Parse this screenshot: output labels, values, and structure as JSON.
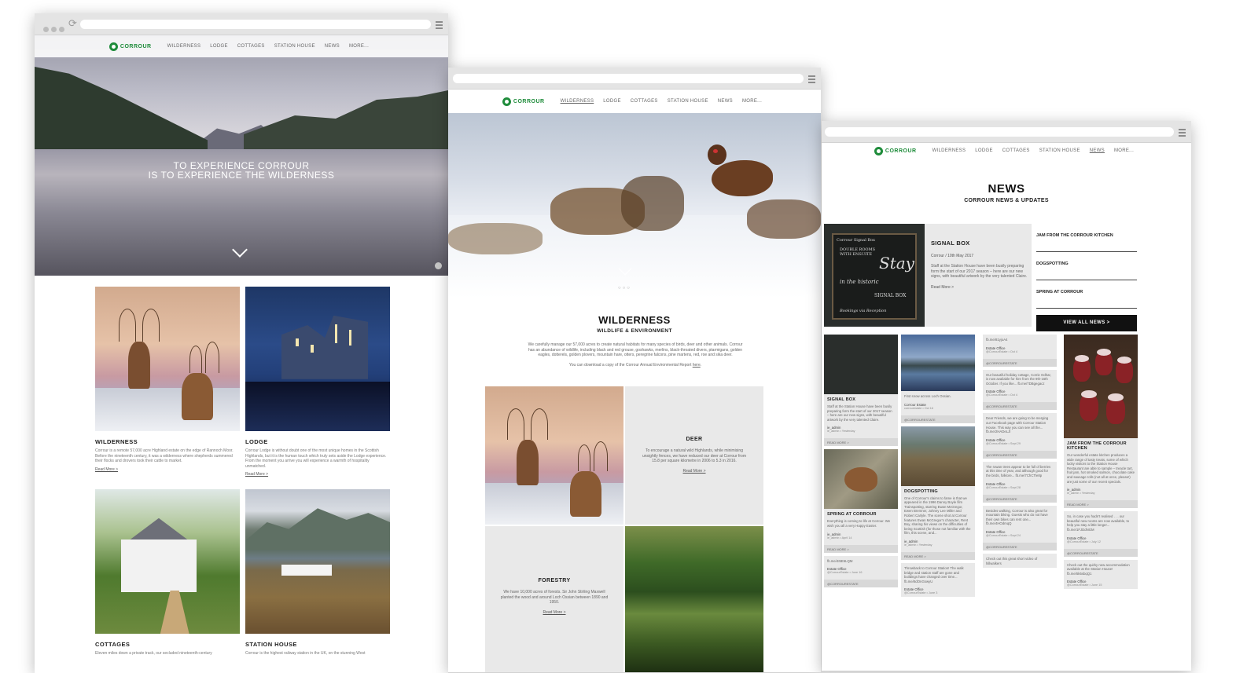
{
  "brand": {
    "name": "CORROUR",
    "color": "#1f8c3b"
  },
  "nav": [
    "WILDERNESS",
    "LODGE",
    "COTTAGES",
    "STATION HOUSE",
    "NEWS",
    "MORE..."
  ],
  "home": {
    "tagline_1": "TO EXPERIENCE CORROUR",
    "tagline_2": "IS TO EXPERIENCE THE WILDERNESS",
    "cards": [
      {
        "title": "WILDERNESS",
        "text": "Corrour is a remote 57,000 acre Highland estate on the edge of Rannoch Moor. Before the nineteenth century, it was a wilderness where shepherds summered their flocks and drovers took their cattle to market.",
        "link": "Read More >"
      },
      {
        "title": "LODGE",
        "text": "Corrour Lodge is without doubt one of the most unique homes in the Scottish Highlands, but it is the human touch which truly sets aside the Lodge experience. From the moment you arrive you will experience a warmth of hospitality unmatched.",
        "link": "Read More >"
      },
      {
        "title": "COTTAGES",
        "text": "Eleven miles down a private track, our secluded nineteenth-century",
        "link": ""
      },
      {
        "title": "STATION HOUSE",
        "text": "Corrour is the highest railway station in the UK, on the stunning West",
        "link": ""
      }
    ]
  },
  "wilderness": {
    "title": "WILDERNESS",
    "subtitle": "WILDLIFE & ENVIRONMENT",
    "body": "We carefully manage our 57,000 acres to create natural habitats for many species of birds, deer and other animals. Corrour has an abundance of wildlife, including black and red grouse, goshawks, merlins, black-throated divers, ptarmigans, golden eagles, dotterels, golden plovers, mountain hare, otters, peregrine falcons, pine martens, red, roe and sika deer.",
    "download_pre": "You can download a copy of the Corrour Annual Environmental Report ",
    "download_link": "here",
    "pager": "○○○",
    "deer": {
      "title": "DEER",
      "text": "To encourage a natural wild Highlands, while minimising unsightly fences, we have reduced our deer at Corrour from 15.8 per square kilometre in 2006 to 5.3 in 2016.",
      "link": "Read More >"
    },
    "forestry": {
      "title": "FORESTRY",
      "text": "We have 10,000 acres of forests. Sir John Stirling Maxwell planted the wood and around Loch Ossian between 1890 and 1950.",
      "link": "Read More >"
    }
  },
  "news": {
    "title": "NEWS",
    "subtitle": "CORROUR NEWS & UPDATES",
    "featured": {
      "title": "SIGNAL BOX",
      "meta": "Corrour / 10th May 2017",
      "text": "Staff at the Station House have been busily preparing form the start of our 2017 season – here are our new signs, with beautiful artwork by the very talented Claire.",
      "link": "Read More >",
      "board_1": "Corrour Signal Box",
      "board_2": "DOUBLE ROOMS WITH ENSUITE",
      "board_3": "Stay",
      "board_4": "in the historic",
      "board_5": "SIGNAL BOX",
      "board_6": "Bookings via Reception"
    },
    "sidebar": [
      "JAM FROM THE CORROUR KITCHEN",
      "DOGSPOTTING",
      "SPRING AT CORROUR"
    ],
    "view_all": "VIEW ALL NEWS >",
    "col1": [
      {
        "title": "SIGNAL BOX",
        "text": "Staff at the Station House have been busily preparing form the start of our 2017 season – here are our new signs, with beautiful artwork by the very talented Claire.",
        "author": "ie_admin",
        "sub": "ie_admin • Yesterday",
        "foot": "READ MORE >"
      },
      {
        "title": "SPRING AT CORROUR",
        "text": "Everything is coming to life at Corrour. We wish you all a very Happy Easter.",
        "author": "ie_admin",
        "sub": "ie_admin • April 14",
        "foot": "READ MORE >"
      },
      {
        "title": "",
        "text": "fb.me/4I5E6LQM",
        "author": "Estate Office",
        "sub": "@CorrourEstate • June 16",
        "foot": "@CORROURESTATE"
      }
    ],
    "col2": [
      {
        "title": "",
        "text": "First snow across Loch Ossian.",
        "author": "Corrour Estate",
        "sub": "corrourestate • Oct 16",
        "foot": "@CORROURESTATE"
      },
      {
        "title": "DOGSPOTTING",
        "text": "One of Corrour's claims to fame is that we appeared in the 1996 Danny Boyle film Trainspotting, starring Ewan McGregor, Ewen Bremner, Johnny Lee Miller and Robert Carlyle. The scene shot at Corrour features Ewan McGregor's character, Rent Boy, sharing his views on the difficulties of being Scottish (for those not familiar with the film, this scene, and...",
        "author": "ie_admin",
        "sub": "ie_admin • Yesterday",
        "foot": "READ MORE >"
      },
      {
        "title": "",
        "text": "Throwback to Corrour Station! The walk bridge and station staff are gone and buildings have changed over time... fb.me/8dOnGswyU",
        "author": "Estate Office",
        "sub": "@CorrourEstate • June 3",
        "foot": ""
      }
    ],
    "col3": [
      {
        "title": "",
        "text": "fb.me/81yjoA4",
        "author": "Estate Office",
        "sub": "@CorrourEstate • Oct 4",
        "foot": "@CORROURESTATE"
      },
      {
        "title": "",
        "text": "Our beautiful holiday cottage, Corrie Odhar, is now available for hire from the 9th-16th October. If you like... fb.me/7DBgegacz",
        "author": "Estate Office",
        "sub": "@CorrourEstate • Oct 4",
        "foot": "@CORROURESTATE"
      },
      {
        "title": "",
        "text": "Dear Friends, we are going to be merging our Facebook page with Corrour Station House. This way you can see all the... fb.me/2HADeLJl",
        "author": "Estate Office",
        "sub": "@CorrourEstate • Sept 29",
        "foot": "@CORROURESTATE"
      },
      {
        "title": "",
        "text": "The rowan trees appear to be full of berries at this time of year, and although good for the birds, folklore... fb.me/7ChCTle8p",
        "author": "Estate Office",
        "sub": "@CorrourEstate • Sept 28",
        "foot": "@CORROURESTATE"
      },
      {
        "title": "",
        "text": "Besides walking, Corrour is also great for mountain biking. Guests who do not have their own bikes can rent one... fb.me/4HOdmqQ",
        "author": "Estate Office",
        "sub": "@CorrourEstate • Sept 24",
        "foot": "@CORROURESTATE"
      },
      {
        "title": "",
        "text": "Check out this great short video of hillwalkers",
        "author": "",
        "sub": "",
        "foot": ""
      }
    ],
    "col4": [
      {
        "title": "JAM FROM THE CORROUR KITCHEN",
        "text": "Our wonderful estate kitchen produces a wide range of tasty treats, some of which lucky visitors to the Station House Restaurant are able to sample – treacle tart, fruit jam, hot smoked salmon, chocolate cake and sausage rolls (not all at once, please!) are just some of our recent specials.",
        "author": "ie_admin",
        "sub": "ie_admin • Yesterday",
        "foot": "READ MORE >"
      },
      {
        "title": "",
        "text": "So, in case you hadn't realised . . . our beautiful new rooms are now available, to help you stay a little longer... fb.me/1FJDdNGM",
        "author": "Estate Office",
        "sub": "@CorrourEstate • July 12",
        "foot": "@CORROURESTATE"
      },
      {
        "title": "",
        "text": "Check out the quirky new accommodation available at the Station House! fb.me/5k5sbqQ1",
        "author": "Estate Office",
        "sub": "@CorrourEstate • June 15",
        "foot": ""
      }
    ]
  }
}
